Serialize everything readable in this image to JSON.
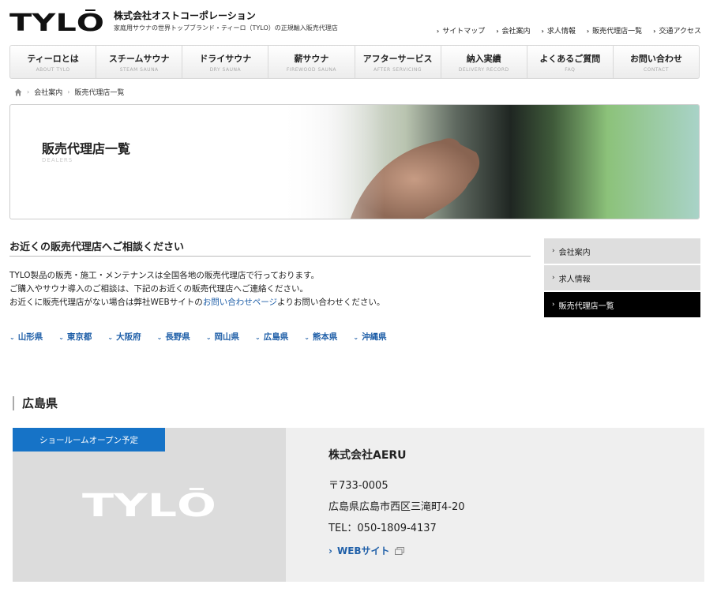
{
  "header": {
    "logo_text": "TYLŌ",
    "company_name": "株式会社オストコーポレーション",
    "tagline": "家庭用サウナの世界トップブランド・ティーロ（TYLO）の正規輸入販売代理店",
    "util_links": [
      "サイトマップ",
      "会社案内",
      "求人情報",
      "販売代理店一覧",
      "交通アクセス"
    ]
  },
  "gnav": [
    {
      "label": "ティーロとは",
      "sub": "ABOUT TYLO"
    },
    {
      "label": "スチームサウナ",
      "sub": "STEAM SAUNA"
    },
    {
      "label": "ドライサウナ",
      "sub": "DRY SAUNA"
    },
    {
      "label": "薪サウナ",
      "sub": "FIREWOOD SAUNA"
    },
    {
      "label": "アフターサービス",
      "sub": "AFTER SERVICING"
    },
    {
      "label": "納入実績",
      "sub": "DELIVERY RECORD"
    },
    {
      "label": "よくあるご質問",
      "sub": "FAQ"
    },
    {
      "label": "お問い合わせ",
      "sub": "CONTACT"
    }
  ],
  "breadcrumb": [
    "会社案内",
    "販売代理店一覧"
  ],
  "hero": {
    "title": "販売代理店一覧",
    "sub": "DEALERS"
  },
  "main": {
    "heading": "お近くの販売代理店へご相談ください",
    "intro_line1": "TYLO製品の販売・施工・メンテナンスは全国各地の販売代理店で行っております。",
    "intro_line2": "ご購入やサウナ導入のご相談は、下記のお近くの販売代理店へご連絡ください。",
    "intro_line3_pre": "お近くに販売代理店がない場合は弊社WEBサイトの",
    "intro_line3_link": "お問い合わせページ",
    "intro_line3_post": "よりお問い合わせください。",
    "prefectures": [
      "山形県",
      "東京都",
      "大阪府",
      "長野県",
      "岡山県",
      "広島県",
      "熊本県",
      "沖縄県"
    ]
  },
  "side_nav": [
    {
      "label": "会社案内",
      "active": false
    },
    {
      "label": "求人情報",
      "active": false
    },
    {
      "label": "販売代理店一覧",
      "active": true
    }
  ],
  "region": {
    "title": "広島県",
    "dealer": {
      "badge": "ショールームオープン予定",
      "logo_text": "TYLŌ",
      "name": "株式会社AERU",
      "postal": "〒733-0005",
      "address": "広島県広島市西区三滝町4-20",
      "tel": "TEL：050-1809-4137",
      "web_label": "WEBサイト"
    }
  },
  "colors": {
    "accent_blue": "#1f5fa8",
    "badge_blue": "#1673c7",
    "active_nav": "#000000"
  }
}
